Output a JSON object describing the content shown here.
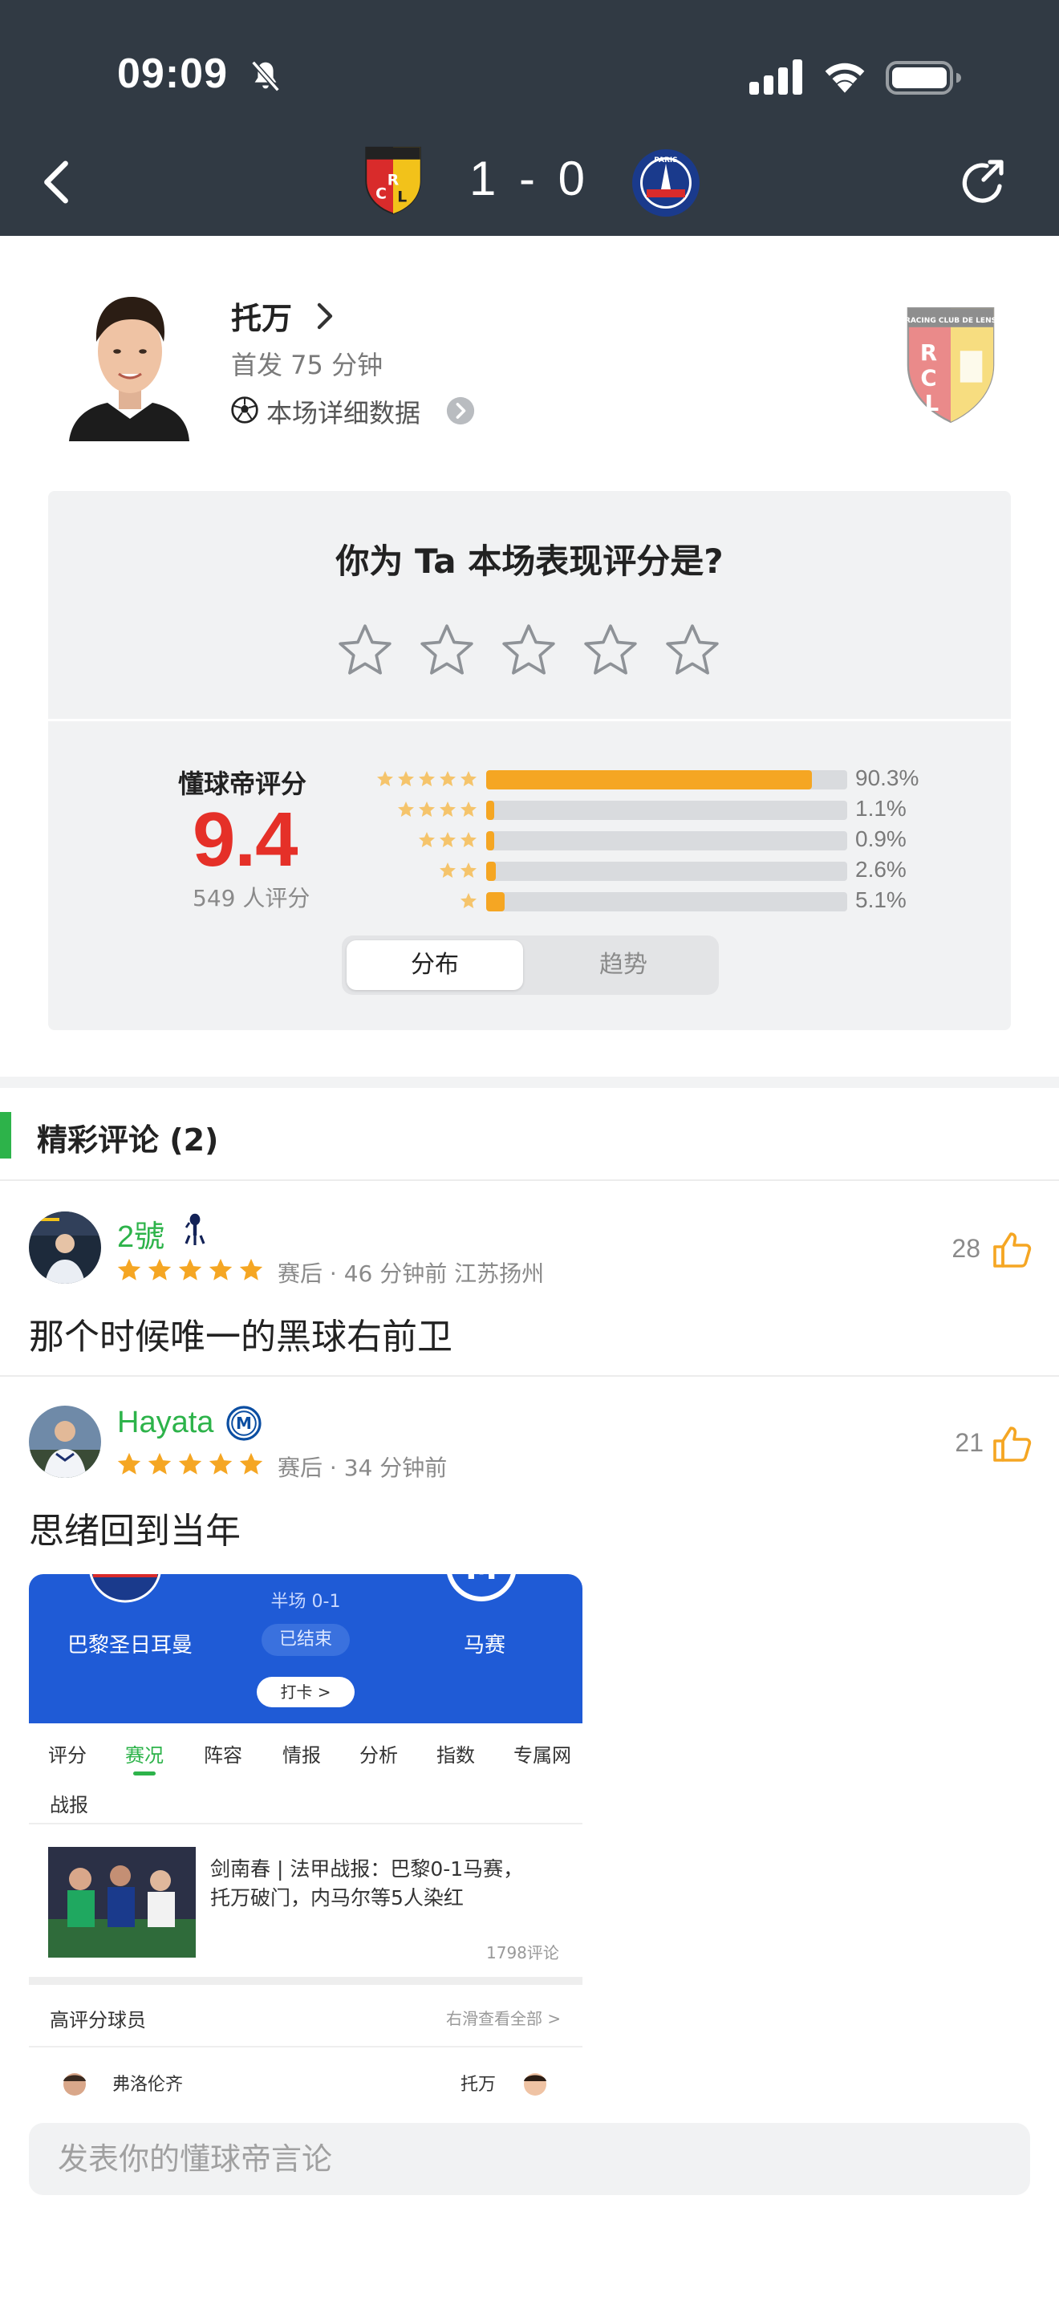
{
  "status_bar": {
    "time": "09:09"
  },
  "match": {
    "score": "1 - 0",
    "home_crest": "racing-club-de-lens-crest",
    "away_crest": "paris-saint-germain-crest"
  },
  "player": {
    "name": "托万",
    "minutes": "首发 75 分钟",
    "detail_link": "本场详细数据"
  },
  "rating_prompt": {
    "question": "你为 Ta 本场表现评分是?"
  },
  "rating_summary": {
    "brand_label": "懂球帝评分",
    "score": "9.4",
    "votes": "549 人评分",
    "distribution": [
      {
        "stars": 5,
        "percent": 90.3,
        "label": "90.3%"
      },
      {
        "stars": 4,
        "percent": 1.1,
        "label": "1.1%"
      },
      {
        "stars": 3,
        "percent": 0.9,
        "label": "0.9%"
      },
      {
        "stars": 2,
        "percent": 2.6,
        "label": "2.6%"
      },
      {
        "stars": 1,
        "percent": 5.1,
        "label": "5.1%"
      }
    ],
    "tabs": {
      "active": "分布",
      "inactive": "趋势"
    }
  },
  "comments_section": {
    "title": "精彩评论 (2)"
  },
  "comments": [
    {
      "user": "2號",
      "rating": 5,
      "meta": "赛后 · 46 分钟前 江苏扬州",
      "likes": "28",
      "text": "那个时候唯一的黑球右前卫",
      "badge": "tottenham-icon"
    },
    {
      "user": "Hayata",
      "rating": 5,
      "meta": "赛后 · 34 分钟前",
      "likes": "21",
      "text": "思绪回到当年",
      "badge": "inter-milan-icon"
    }
  ],
  "embedded_screenshot": {
    "halftime": "半场 0-1",
    "home_team": "巴黎圣日耳曼",
    "status": "已结束",
    "away_team": "马赛",
    "checkin": "打卡 >",
    "tabs": [
      "评分",
      "赛况",
      "阵容",
      "情报",
      "分析",
      "指数",
      "专属网"
    ],
    "active_tab": "赛况",
    "report_label": "战报",
    "news_title_1": "剑南春 | 法甲战报：巴黎0-1马赛，",
    "news_title_2": "托万破门，内马尔等5人染红",
    "news_comments": "1798评论",
    "high_rated_label": "高评分球员",
    "see_all": "右滑查看全部 >",
    "player_left": "弗洛伦齐",
    "player_right": "托万"
  },
  "input": {
    "placeholder": "发表你的懂球帝言论"
  },
  "colors": {
    "header": "#313a44",
    "accent_green": "#2db34a",
    "score_red": "#e53028",
    "star_orange": "#f5a623"
  }
}
